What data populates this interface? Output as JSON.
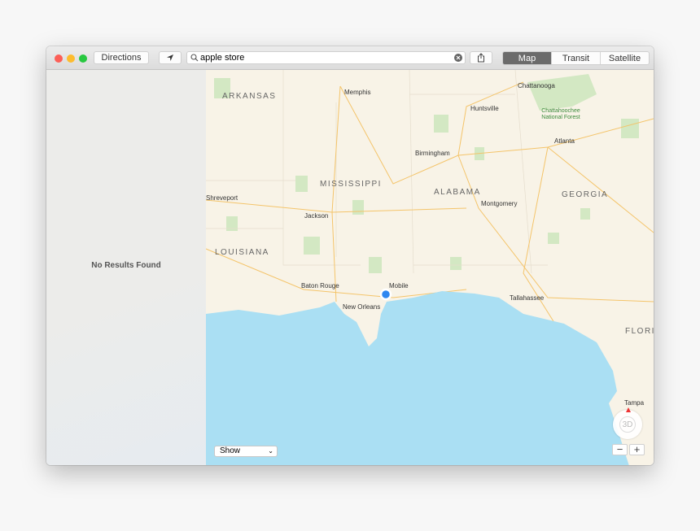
{
  "toolbar": {
    "directions_label": "Directions",
    "location_icon": "location-arrow-icon",
    "search_value": "apple store",
    "search_icon": "magnifier-icon",
    "clear_icon": "clear-circle-icon",
    "share_icon": "share-icon",
    "map_types": [
      {
        "label": "Map",
        "active": true
      },
      {
        "label": "Transit",
        "active": false
      },
      {
        "label": "Satellite",
        "active": false
      }
    ]
  },
  "sidebar": {
    "message": "No Results Found"
  },
  "map": {
    "states": [
      "ARKANSAS",
      "MISSISSIPPI",
      "ALABAMA",
      "GEORGIA",
      "LOUISIANA",
      "FLORI"
    ],
    "cities": [
      "Memphis",
      "Chattanooga",
      "Huntsville",
      "Chattahoochee National Forest",
      "Birmingham",
      "Atlanta",
      "Shreveport",
      "Montgomery",
      "Jackson",
      "Baton Rouge",
      "Mobile",
      "New Orleans",
      "Tallahassee",
      "Tampa"
    ],
    "show_label": "Show",
    "compass_label": "3D",
    "zoom_out": "−",
    "zoom_in": "+",
    "colors": {
      "land": "#f8f3e7",
      "water": "#aadff3",
      "park": "#d3e8c3",
      "road": "#f4c46a",
      "user_location": "#2f87f0"
    }
  }
}
